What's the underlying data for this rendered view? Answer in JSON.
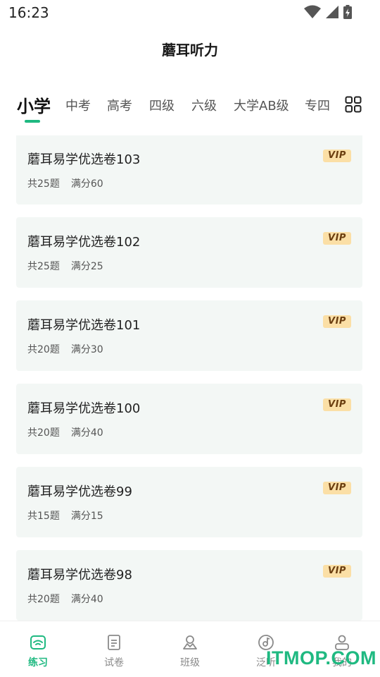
{
  "status_bar": {
    "time": "16:23"
  },
  "header": {
    "title": "蘑耳听力"
  },
  "tabs": [
    {
      "label": "小学",
      "active": true
    },
    {
      "label": "中考"
    },
    {
      "label": "高考"
    },
    {
      "label": "四级"
    },
    {
      "label": "六级"
    },
    {
      "label": "大学AB级"
    },
    {
      "label": "专四"
    }
  ],
  "papers": [
    {
      "title": "蘑耳易学优选卷103",
      "count": "共25题",
      "score": "满分60",
      "badge": "VIP"
    },
    {
      "title": "蘑耳易学优选卷102",
      "count": "共25题",
      "score": "满分25",
      "badge": "VIP"
    },
    {
      "title": "蘑耳易学优选卷101",
      "count": "共20题",
      "score": "满分30",
      "badge": "VIP"
    },
    {
      "title": "蘑耳易学优选卷100",
      "count": "共20题",
      "score": "满分40",
      "badge": "VIP"
    },
    {
      "title": "蘑耳易学优选卷99",
      "count": "共15题",
      "score": "满分15",
      "badge": "VIP"
    },
    {
      "title": "蘑耳易学优选卷98",
      "count": "共20题",
      "score": "满分40",
      "badge": "VIP"
    }
  ],
  "bottom_nav": [
    {
      "label": "练习",
      "icon": "practice-icon",
      "active": true
    },
    {
      "label": "试卷",
      "icon": "paper-icon"
    },
    {
      "label": "班级",
      "icon": "class-icon"
    },
    {
      "label": "泛听",
      "icon": "listen-icon"
    },
    {
      "label": "我的",
      "icon": "profile-icon"
    }
  ],
  "watermark": "ITMOP.COM",
  "colors": {
    "accent": "#1fb981",
    "card_bg": "#f3f7f5",
    "vip_bg": "#fbdfa6",
    "vip_text": "#6b3e10"
  }
}
